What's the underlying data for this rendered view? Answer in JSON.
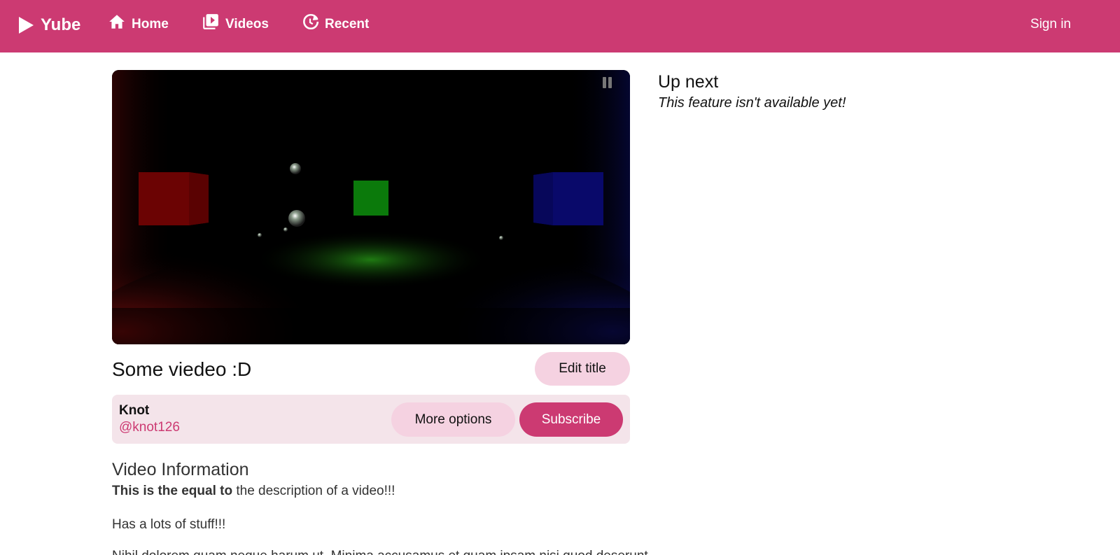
{
  "header": {
    "brand": "Yube",
    "nav": [
      {
        "label": "Home",
        "icon": "home-icon"
      },
      {
        "label": "Videos",
        "icon": "video-library-icon"
      },
      {
        "label": "Recent",
        "icon": "history-icon"
      }
    ],
    "signin": "Sign in"
  },
  "colors": {
    "accent": "#cc3a72",
    "accent_light": "#f5d2e1",
    "panel_bg": "#f4e4ea"
  },
  "video": {
    "title": "Some viedeo :D",
    "edit_label": "Edit title"
  },
  "channel": {
    "name": "Knot",
    "handle": "@knot126",
    "more_label": "More options",
    "subscribe_label": "Subscribe"
  },
  "info": {
    "heading": "Video Information",
    "desc_bold": "This is the equal to",
    "desc_rest": " the description of a video!!!",
    "desc_line2": "Has a lots of stuff!!!",
    "desc_line3": "Nihil dolorem quam neque harum ut. Minima accusamus et quam ipsam nisi quod deserunt..."
  },
  "sidebar": {
    "title": "Up next",
    "message": "This feature isn't available yet!"
  }
}
